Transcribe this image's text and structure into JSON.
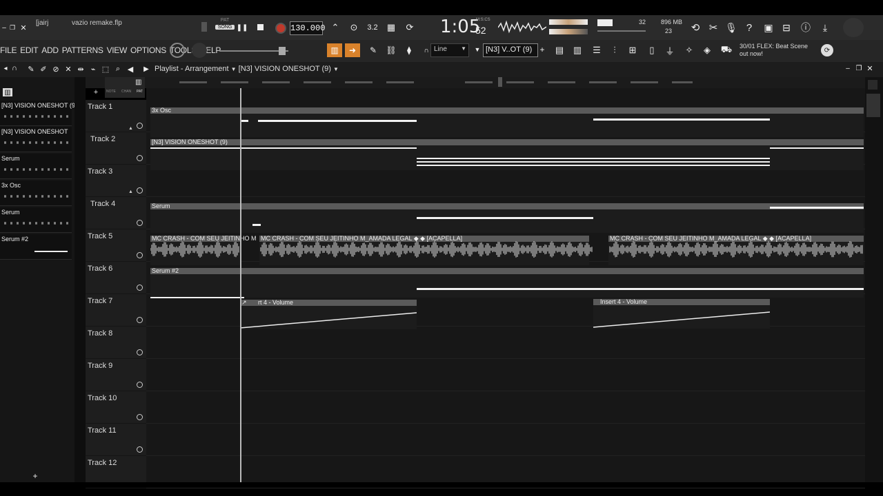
{
  "window": {
    "file_title": "vazio remake.flp",
    "user": "[jairj"
  },
  "transport": {
    "mode_pat": "PAT",
    "mode_song": "SONG",
    "tempo": "130.000",
    "time": "1:05",
    "time_small": "52",
    "time_unit": "M:S:CS",
    "cpu_number": "32",
    "memory": "896 MB",
    "poly": "23",
    "step_label": "3.2"
  },
  "menu": [
    "FILE",
    "EDIT",
    "ADD",
    "PATTERNS",
    "VIEW",
    "OPTIONS",
    "TOOLS",
    "HELP"
  ],
  "toolbar": {
    "snap": "Line",
    "pattern_selector": "[N3] V..OT (9)",
    "news_line1": "30/01  FLEX: Beat Scene",
    "news_line2": "out now!"
  },
  "playlist": {
    "breadcrumb": "Playlist - Arrangement",
    "pattern": "[N3] VISION ONESHOT (9)",
    "header_labels": {
      "note": "NOTE",
      "chan": "CHAN",
      "pat": "PAT"
    }
  },
  "browser_items": [
    "[N3] VISION ONESHOT (9)",
    "[N3] VISION ONESHOT",
    "Serum",
    "3x Osc",
    "Serum",
    "Serum #2"
  ],
  "tracks": [
    "Track 1",
    "Track 2",
    "Track 3",
    "Track 4",
    "Track 5",
    "Track 6",
    "Track 7",
    "Track 8",
    "Track 9",
    "Track 10",
    "Track 11",
    "Track 12"
  ],
  "clips": {
    "osc": "3x Osc",
    "vision": "[N3] VISION ONESHOT (9)",
    "serum": "Serum",
    "audio1": "MC CRASH - COM SEU JEITINHO M",
    "audio2": "MC CRASH - COM SEU JEITINHO M_AMADA LEGAL ◆ ◆ [ACAPELLA]",
    "audio3": "MC CRASH - COM SEU JEITINHO M_AMADA LEGAL ◆ ◆ [ACAPELLA]",
    "serum2": "Serum #2",
    "auto1": "rt 4 - Volume",
    "auto2": "Insert 4 - Volume"
  }
}
